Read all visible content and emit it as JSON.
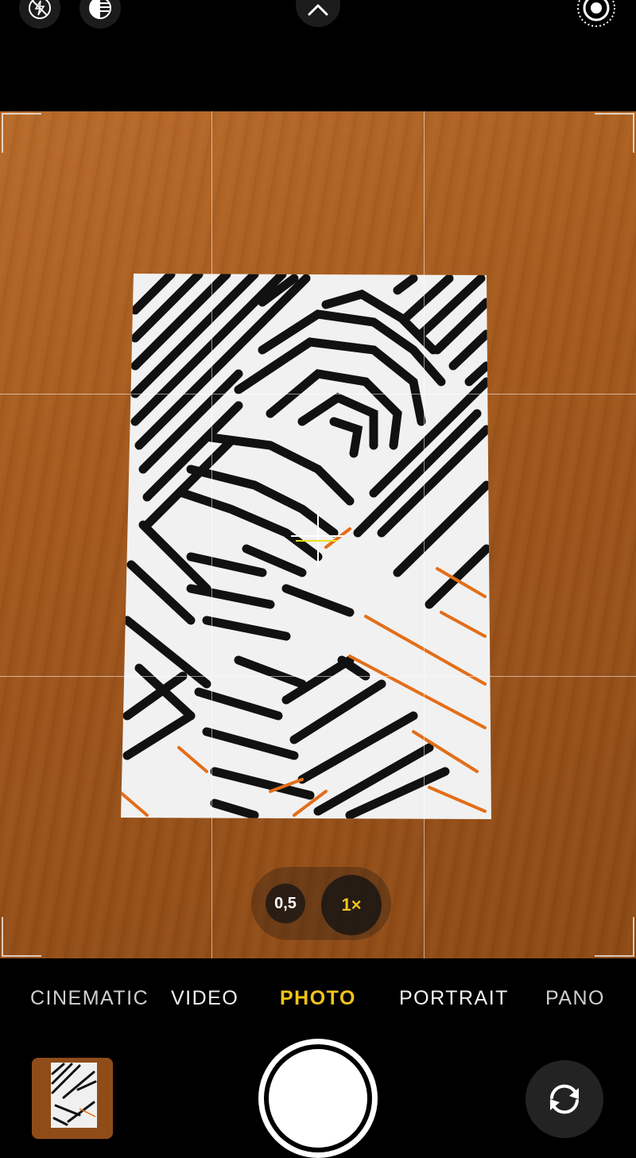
{
  "zoom": {
    "options": [
      {
        "label": "0,5",
        "selected": false
      },
      {
        "label": "1×",
        "selected": true
      }
    ],
    "accent_color": "#f2c318"
  },
  "modes": [
    {
      "label": "CINEMATIC",
      "selected": false
    },
    {
      "label": "VIDEO",
      "selected": false
    },
    {
      "label": "PHOTO",
      "selected": true
    },
    {
      "label": "PORTRAIT",
      "selected": false
    },
    {
      "label": "PANO",
      "selected": false
    }
  ],
  "icons": {
    "flash": "flash-off-icon",
    "night": "night-mode-icon",
    "chevron": "chevron-up-icon",
    "live": "live-photo-icon",
    "flip": "flip-camera-icon"
  }
}
